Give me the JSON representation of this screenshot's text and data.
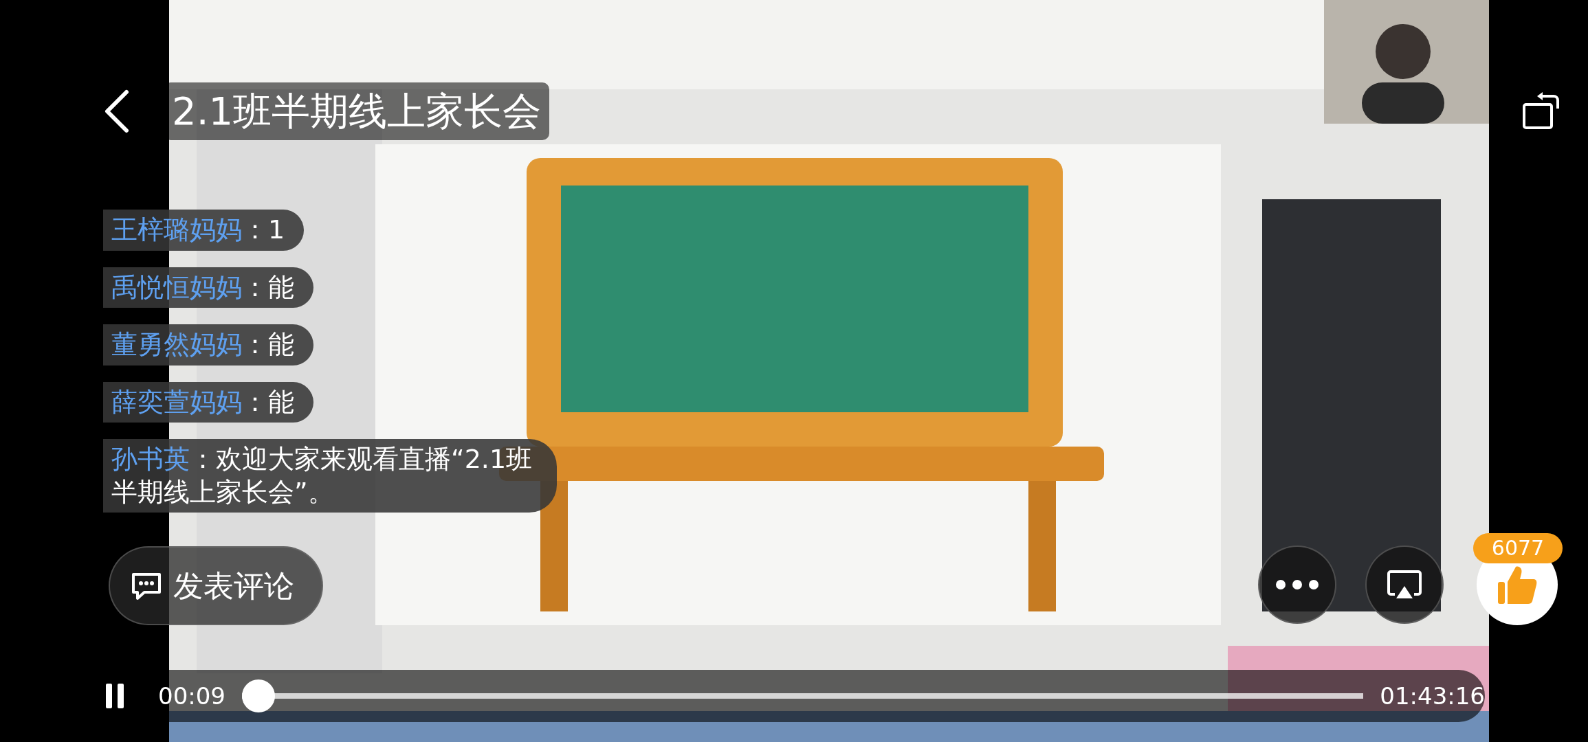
{
  "title": "2.1班半期线上家长会",
  "comments": [
    {
      "user": "王梓璐妈妈",
      "text": "：1"
    },
    {
      "user": "禹悦恒妈妈",
      "text": "：能"
    },
    {
      "user": "董勇然妈妈",
      "text": "：能"
    },
    {
      "user": "薛奕萱妈妈",
      "text": "：能"
    },
    {
      "user": "孙书英",
      "text": "：欢迎大家来观看直播“2.1班半期线上家长会”。"
    }
  ],
  "comment_button": {
    "label": "发表评论"
  },
  "likes": {
    "count": "6077"
  },
  "player": {
    "playing": true,
    "elapsed": "00:09",
    "level": 0,
    "duration": "01:43:16"
  }
}
